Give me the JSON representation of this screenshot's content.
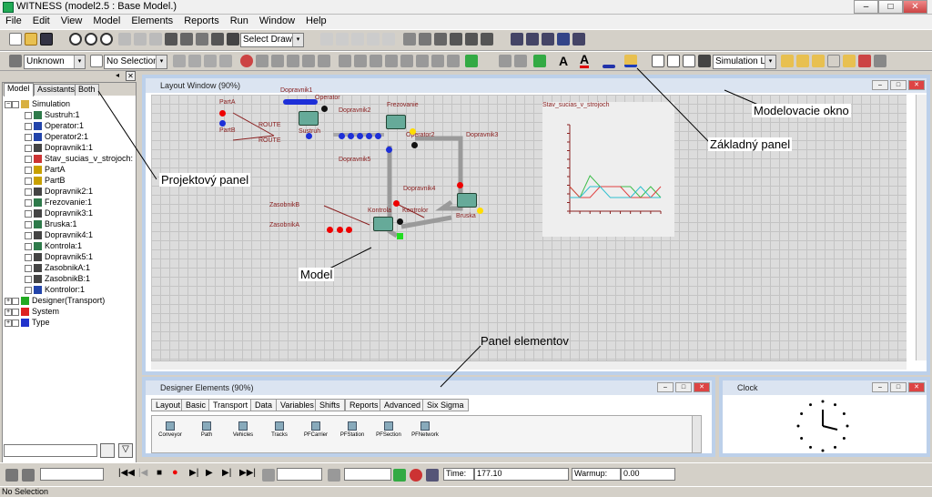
{
  "window": {
    "title": "WITNESS (model2.5 : Base Model.)",
    "min": "–",
    "max": "□",
    "close": "✕"
  },
  "menu": [
    "File",
    "Edit",
    "View",
    "Model",
    "Elements",
    "Reports",
    "Run",
    "Window",
    "Help"
  ],
  "toolbar": {
    "select_drawing": "Select Drawing",
    "unknown": "Unknown",
    "no_selection": "No Selection",
    "sim_layer": "Simulation Laye",
    "text_a": "A",
    "arrow": "▾"
  },
  "project_panel": {
    "tabs": [
      "Model",
      "Assistants",
      "Both"
    ],
    "tree": [
      {
        "label": "Simulation",
        "icon": "folder-icon",
        "color": "#d8b040"
      },
      {
        "label": "Sustruh:1",
        "icon": "machine-icon",
        "color": "#2e7a4a"
      },
      {
        "label": "Operator:1",
        "icon": "labor-icon",
        "color": "#2244aa"
      },
      {
        "label": "Operator2:1",
        "icon": "labor-icon",
        "color": "#2244aa"
      },
      {
        "label": "Dopravnik1:1",
        "icon": "conveyor-icon",
        "color": "#444"
      },
      {
        "label": "Stav_sucias_v_strojoch:",
        "icon": "timeseries-icon",
        "color": "#cc3333"
      },
      {
        "label": "PartA",
        "icon": "part-icon",
        "color": "#c8a000"
      },
      {
        "label": "PartB",
        "icon": "part-icon",
        "color": "#c8a000"
      },
      {
        "label": "Dopravnik2:1",
        "icon": "conveyor-icon",
        "color": "#444"
      },
      {
        "label": "Frezovanie:1",
        "icon": "machine-icon",
        "color": "#2e7a4a"
      },
      {
        "label": "Dopravnik3:1",
        "icon": "conveyor-icon",
        "color": "#444"
      },
      {
        "label": "Bruska:1",
        "icon": "machine-icon",
        "color": "#2e7a4a"
      },
      {
        "label": "Dopravnik4:1",
        "icon": "conveyor-icon",
        "color": "#444"
      },
      {
        "label": "Kontrola:1",
        "icon": "machine-icon",
        "color": "#2e7a4a"
      },
      {
        "label": "Dopravnik5:1",
        "icon": "conveyor-icon",
        "color": "#444"
      },
      {
        "label": "ZasobnikA:1",
        "icon": "buffer-icon",
        "color": "#444"
      },
      {
        "label": "ZasobnikB:1",
        "icon": "buffer-icon",
        "color": "#444"
      },
      {
        "label": "Kontrolor:1",
        "icon": "labor-icon",
        "color": "#2244aa"
      },
      {
        "label": "Designer(Transport)",
        "icon": "designer-icon",
        "color": "#22aa22"
      },
      {
        "label": "System",
        "icon": "system-icon",
        "color": "#dd2222"
      },
      {
        "label": "Type",
        "icon": "type-icon",
        "color": "#2233cc"
      }
    ]
  },
  "layout_window": {
    "title": "Layout Window (90%)",
    "labels": {
      "dopravnik1": "Dopravnik1",
      "operator": "Operator",
      "parta": "PartA",
      "partb": "PartB",
      "route1": "ROUTE",
      "route2": "ROUTE",
      "sustruh": "Sustruh",
      "dopravnik2": "Dopravnik2",
      "frezovanie": "Frezovanie",
      "operator2": "Operator2",
      "dopravnik3": "Dopravnik3",
      "dopravnik5": "Dopravnik5",
      "dopravnik4": "Dopravnik4",
      "zasobnikb": "ZasobnikB",
      "zasobnika": "ZasobnikA",
      "kontrola": "Kontrola",
      "kontrolor": "Kontrolor",
      "bruska": "Bruska",
      "chart_title": "Stav_sucias_v_strojoch"
    }
  },
  "annotations": {
    "modelovacie_okno": "Modelovacie okno",
    "zakladny_panel": "Základný panel",
    "projektovy_panel": "Projektový panel",
    "model": "Model",
    "panel_elementov": "Panel elementov"
  },
  "designer": {
    "title": "Designer Elements (90%)",
    "tabs": [
      "Layout",
      "Basic",
      "Transport",
      "Data",
      "Variables",
      "Shifts",
      "Reports",
      "Advanced",
      "Six Sigma"
    ],
    "elements": [
      "Conveyor",
      "Path",
      "Vehicles",
      "Tracks",
      "PFCarrier",
      "PFStation",
      "PFSection",
      "PFNetwork"
    ]
  },
  "clock": {
    "title": "Clock"
  },
  "runbar": {
    "time_label": "Time:",
    "time_value": "177.10",
    "warmup_label": "Warmup:",
    "warmup_value": "0.00"
  },
  "status": {
    "text": "No Selection"
  },
  "chart_data": {
    "type": "line",
    "title": "Stav_sucias_v_strojoch",
    "note": "embedded time-series plot inside layout window; values approximate",
    "series": [
      {
        "color": "#3dbd4a",
        "values": [
          1,
          0,
          2,
          1,
          1,
          1,
          1,
          0,
          1,
          0
        ]
      },
      {
        "color": "#e04040",
        "values": [
          1,
          0,
          0,
          1,
          1,
          1,
          0,
          0,
          0,
          1
        ]
      },
      {
        "color": "#30c0d0",
        "values": [
          0,
          0,
          1,
          1,
          0,
          0,
          0,
          1,
          0,
          0
        ]
      }
    ]
  }
}
